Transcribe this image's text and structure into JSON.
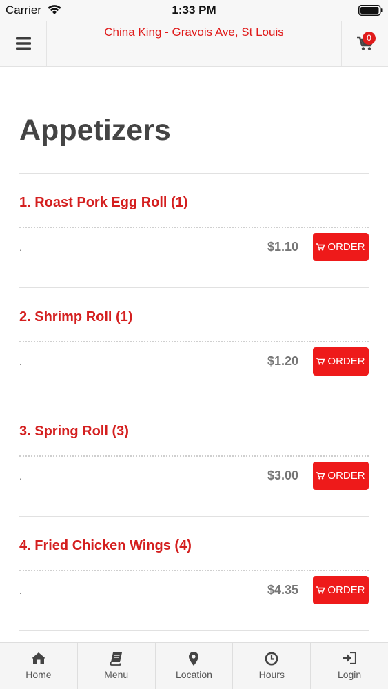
{
  "status_bar": {
    "carrier": "Carrier",
    "time": "1:33 PM"
  },
  "header": {
    "title": "China King - Gravois Ave, St Louis",
    "cart_count": "0"
  },
  "section": {
    "title": "Appetizers"
  },
  "items": [
    {
      "name": "1. Roast Pork Egg Roll (1)",
      "description": ".",
      "price": "$1.10",
      "order_label": "ORDER"
    },
    {
      "name": "2. Shrimp Roll (1)",
      "description": ".",
      "price": "$1.20",
      "order_label": "ORDER"
    },
    {
      "name": "3. Spring Roll (3)",
      "description": ".",
      "price": "$3.00",
      "order_label": "ORDER"
    },
    {
      "name": "4. Fried Chicken Wings (4)",
      "description": ".",
      "price": "$4.35",
      "order_label": "ORDER"
    }
  ],
  "tabs": [
    {
      "label": "Home",
      "icon": "home-icon"
    },
    {
      "label": "Menu",
      "icon": "book-icon"
    },
    {
      "label": "Location",
      "icon": "map-pin-icon"
    },
    {
      "label": "Hours",
      "icon": "clock-icon"
    },
    {
      "label": "Login",
      "icon": "login-icon"
    }
  ],
  "colors": {
    "brand_red": "#e01b1b",
    "button_red": "#ee1a1a",
    "heading_gray": "#444444"
  }
}
